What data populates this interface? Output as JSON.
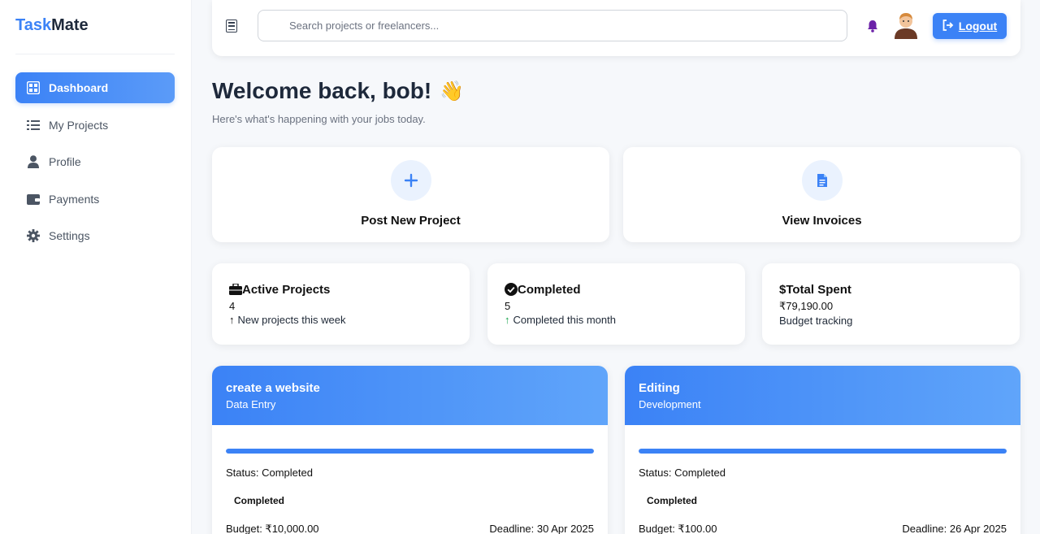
{
  "brand": {
    "part1": "Task",
    "part2": "Mate"
  },
  "sidebar": {
    "items": [
      {
        "label": "Dashboard",
        "icon": "grid-icon",
        "active": true
      },
      {
        "label": "My Projects",
        "icon": "list-icon"
      },
      {
        "label": "Profile",
        "icon": "user-icon"
      },
      {
        "label": "Payments",
        "icon": "wallet-icon"
      },
      {
        "label": "Settings",
        "icon": "gear-icon"
      }
    ]
  },
  "topbar": {
    "search_placeholder": "Search projects or freelancers...",
    "logout_label": "Logout"
  },
  "welcome": {
    "title": "Welcome back, bob!",
    "emoji": "👋",
    "subtitle": "Here's what's happening with your jobs today."
  },
  "actions": [
    {
      "label": "Post New Project",
      "icon": "plus-icon"
    },
    {
      "label": "View Invoices",
      "icon": "invoice-icon"
    }
  ],
  "stats": [
    {
      "title": "Active Projects",
      "icon": "briefcase-icon",
      "value": "4",
      "note": "New projects this week",
      "arrow": "↑"
    },
    {
      "title": "Completed",
      "icon": "check-circle-icon",
      "value": "5",
      "note": "Completed this month",
      "arrow": "↑"
    },
    {
      "title": "Total Spent",
      "icon": "dollar-icon",
      "value": "₹79,190.00",
      "note": "Budget tracking",
      "prefix": "$"
    }
  ],
  "projects": [
    {
      "title": "create a website",
      "category": "Data Entry",
      "progress": 100,
      "status": "Status: Completed",
      "badge": "Completed",
      "budget": "Budget: ₹10,000.00",
      "deadline": "Deadline: 30 Apr 2025"
    },
    {
      "title": "Editing",
      "category": "Development",
      "progress": 100,
      "status": "Status: Completed",
      "badge": "Completed",
      "budget": "Budget: ₹100.00",
      "deadline": "Deadline: 26 Apr 2025"
    }
  ],
  "colors": {
    "accent": "#3b82f6",
    "accent_light": "#60a5fa",
    "bell": "#6b21a8"
  }
}
